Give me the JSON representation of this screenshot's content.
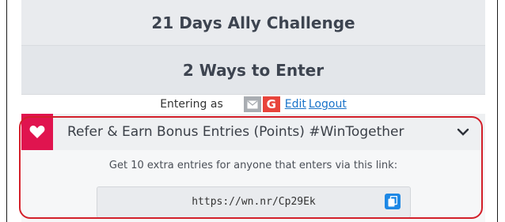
{
  "header": {
    "title": "21 Days Ally Challenge",
    "subtitle": "2 Ways to Enter"
  },
  "entering": {
    "label": "Entering as",
    "google_letter": "G",
    "edit_link": "Edit",
    "logout_link": "Logout"
  },
  "entry": {
    "title": "Refer & Earn Bonus Entries (Points) #WinTogether",
    "description": "Get 10 extra entries for anyone that enters via this link:",
    "referral_url": "https://wn.nr/Cp29Ek"
  },
  "icons": {
    "heart": "heart-icon",
    "mail": "mail-icon",
    "chevron": "chevron-down-icon",
    "copy": "copy-icon"
  },
  "colors": {
    "accent_red": "#e0144f",
    "highlight_red": "#d3202a",
    "link_blue": "#1a73c9",
    "copy_blue": "#1e88e5"
  }
}
